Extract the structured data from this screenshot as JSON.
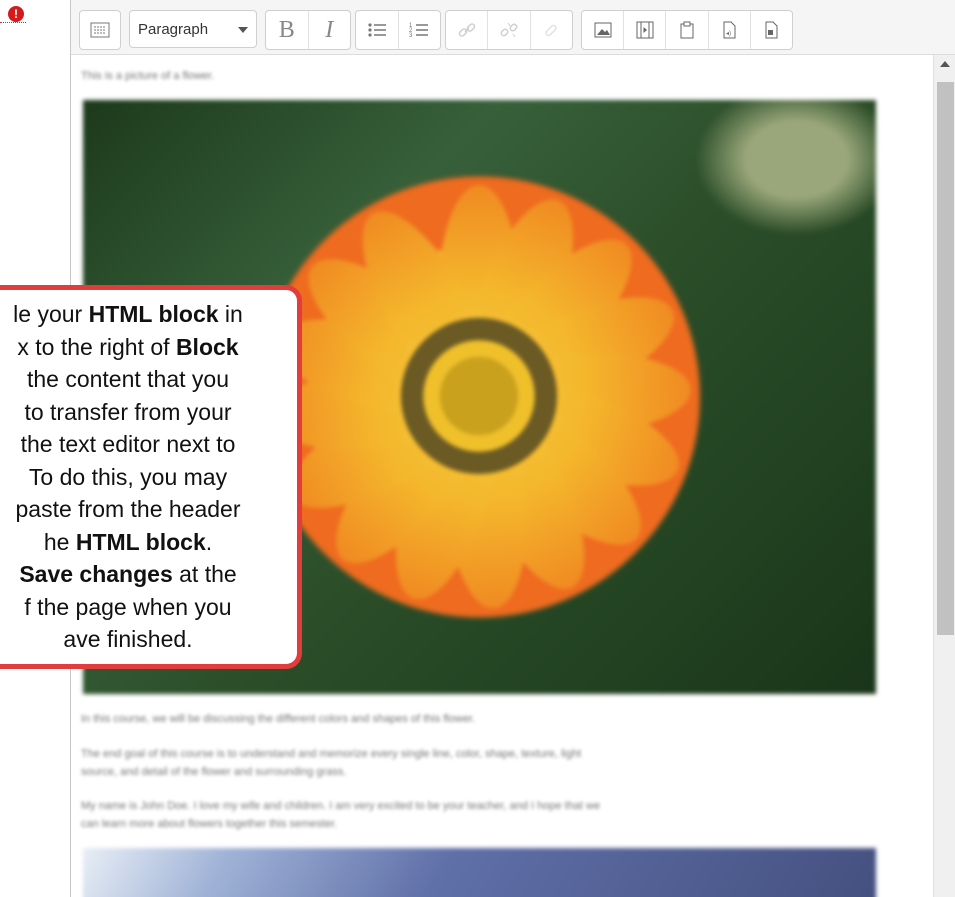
{
  "toolbar": {
    "format_select": "Paragraph",
    "bold_label": "B",
    "italic_label": "I"
  },
  "content": {
    "paragraph1": "This is a picture of a flower.",
    "paragraph2": "In this course, we will be discussing the different colors and shapes of this flower.",
    "paragraph3_line1": "The end goal of this course is to understand and memorize every single line, color, shape, texture, light",
    "paragraph3_line2": "source, and detail of the flower and surrounding grass.",
    "paragraph4_line1": "My name is John Doe. I love my wife and children. I am very excited to be your teacher, and I hope that we",
    "paragraph4_line2": "can learn more about flowers together this semester."
  },
  "callout": {
    "l1a": "le your ",
    "l1b": "HTML block",
    "l1c": " in",
    "l2a": "x to the right of ",
    "l2b": "Block",
    "l3": " the content that you",
    "l4": "to transfer from your",
    "l5": "the text editor next to",
    "l6": "To do this, you may",
    "l7": "paste from the header",
    "l8a": "he ",
    "l8b": "HTML block",
    "l8c": ".",
    "l9a": "Save changes",
    "l9b": " at the",
    "l10": "f the page when you",
    "l11": "ave finished."
  },
  "icons": {
    "required": "exclamation-circle-icon",
    "toggle_toolbar": "toolbar-toggle-icon",
    "unordered_list": "unordered-list-icon",
    "ordered_list": "ordered-list-icon",
    "link": "link-icon",
    "unlink": "unlink-icon",
    "image": "image-icon",
    "media": "media-icon",
    "manage_files": "manage-files-icon",
    "accessibility_checker": "accessibility-checker-icon",
    "screenreader_helper": "screenreader-helper-icon"
  },
  "colors": {
    "callout_border": "#e23c3c",
    "required_icon": "#d41a1a"
  }
}
